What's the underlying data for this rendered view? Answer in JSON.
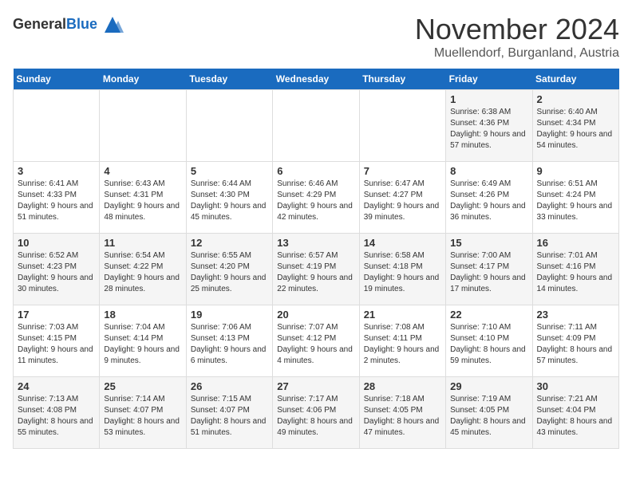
{
  "header": {
    "logo_general": "General",
    "logo_blue": "Blue",
    "month": "November 2024",
    "location": "Muellendorf, Burganland, Austria"
  },
  "days_of_week": [
    "Sunday",
    "Monday",
    "Tuesday",
    "Wednesday",
    "Thursday",
    "Friday",
    "Saturday"
  ],
  "weeks": [
    [
      {
        "day": "",
        "info": ""
      },
      {
        "day": "",
        "info": ""
      },
      {
        "day": "",
        "info": ""
      },
      {
        "day": "",
        "info": ""
      },
      {
        "day": "",
        "info": ""
      },
      {
        "day": "1",
        "info": "Sunrise: 6:38 AM\nSunset: 4:36 PM\nDaylight: 9 hours and 57 minutes."
      },
      {
        "day": "2",
        "info": "Sunrise: 6:40 AM\nSunset: 4:34 PM\nDaylight: 9 hours and 54 minutes."
      }
    ],
    [
      {
        "day": "3",
        "info": "Sunrise: 6:41 AM\nSunset: 4:33 PM\nDaylight: 9 hours and 51 minutes."
      },
      {
        "day": "4",
        "info": "Sunrise: 6:43 AM\nSunset: 4:31 PM\nDaylight: 9 hours and 48 minutes."
      },
      {
        "day": "5",
        "info": "Sunrise: 6:44 AM\nSunset: 4:30 PM\nDaylight: 9 hours and 45 minutes."
      },
      {
        "day": "6",
        "info": "Sunrise: 6:46 AM\nSunset: 4:29 PM\nDaylight: 9 hours and 42 minutes."
      },
      {
        "day": "7",
        "info": "Sunrise: 6:47 AM\nSunset: 4:27 PM\nDaylight: 9 hours and 39 minutes."
      },
      {
        "day": "8",
        "info": "Sunrise: 6:49 AM\nSunset: 4:26 PM\nDaylight: 9 hours and 36 minutes."
      },
      {
        "day": "9",
        "info": "Sunrise: 6:51 AM\nSunset: 4:24 PM\nDaylight: 9 hours and 33 minutes."
      }
    ],
    [
      {
        "day": "10",
        "info": "Sunrise: 6:52 AM\nSunset: 4:23 PM\nDaylight: 9 hours and 30 minutes."
      },
      {
        "day": "11",
        "info": "Sunrise: 6:54 AM\nSunset: 4:22 PM\nDaylight: 9 hours and 28 minutes."
      },
      {
        "day": "12",
        "info": "Sunrise: 6:55 AM\nSunset: 4:20 PM\nDaylight: 9 hours and 25 minutes."
      },
      {
        "day": "13",
        "info": "Sunrise: 6:57 AM\nSunset: 4:19 PM\nDaylight: 9 hours and 22 minutes."
      },
      {
        "day": "14",
        "info": "Sunrise: 6:58 AM\nSunset: 4:18 PM\nDaylight: 9 hours and 19 minutes."
      },
      {
        "day": "15",
        "info": "Sunrise: 7:00 AM\nSunset: 4:17 PM\nDaylight: 9 hours and 17 minutes."
      },
      {
        "day": "16",
        "info": "Sunrise: 7:01 AM\nSunset: 4:16 PM\nDaylight: 9 hours and 14 minutes."
      }
    ],
    [
      {
        "day": "17",
        "info": "Sunrise: 7:03 AM\nSunset: 4:15 PM\nDaylight: 9 hours and 11 minutes."
      },
      {
        "day": "18",
        "info": "Sunrise: 7:04 AM\nSunset: 4:14 PM\nDaylight: 9 hours and 9 minutes."
      },
      {
        "day": "19",
        "info": "Sunrise: 7:06 AM\nSunset: 4:13 PM\nDaylight: 9 hours and 6 minutes."
      },
      {
        "day": "20",
        "info": "Sunrise: 7:07 AM\nSunset: 4:12 PM\nDaylight: 9 hours and 4 minutes."
      },
      {
        "day": "21",
        "info": "Sunrise: 7:08 AM\nSunset: 4:11 PM\nDaylight: 9 hours and 2 minutes."
      },
      {
        "day": "22",
        "info": "Sunrise: 7:10 AM\nSunset: 4:10 PM\nDaylight: 8 hours and 59 minutes."
      },
      {
        "day": "23",
        "info": "Sunrise: 7:11 AM\nSunset: 4:09 PM\nDaylight: 8 hours and 57 minutes."
      }
    ],
    [
      {
        "day": "24",
        "info": "Sunrise: 7:13 AM\nSunset: 4:08 PM\nDaylight: 8 hours and 55 minutes."
      },
      {
        "day": "25",
        "info": "Sunrise: 7:14 AM\nSunset: 4:07 PM\nDaylight: 8 hours and 53 minutes."
      },
      {
        "day": "26",
        "info": "Sunrise: 7:15 AM\nSunset: 4:07 PM\nDaylight: 8 hours and 51 minutes."
      },
      {
        "day": "27",
        "info": "Sunrise: 7:17 AM\nSunset: 4:06 PM\nDaylight: 8 hours and 49 minutes."
      },
      {
        "day": "28",
        "info": "Sunrise: 7:18 AM\nSunset: 4:05 PM\nDaylight: 8 hours and 47 minutes."
      },
      {
        "day": "29",
        "info": "Sunrise: 7:19 AM\nSunset: 4:05 PM\nDaylight: 8 hours and 45 minutes."
      },
      {
        "day": "30",
        "info": "Sunrise: 7:21 AM\nSunset: 4:04 PM\nDaylight: 8 hours and 43 minutes."
      }
    ]
  ]
}
